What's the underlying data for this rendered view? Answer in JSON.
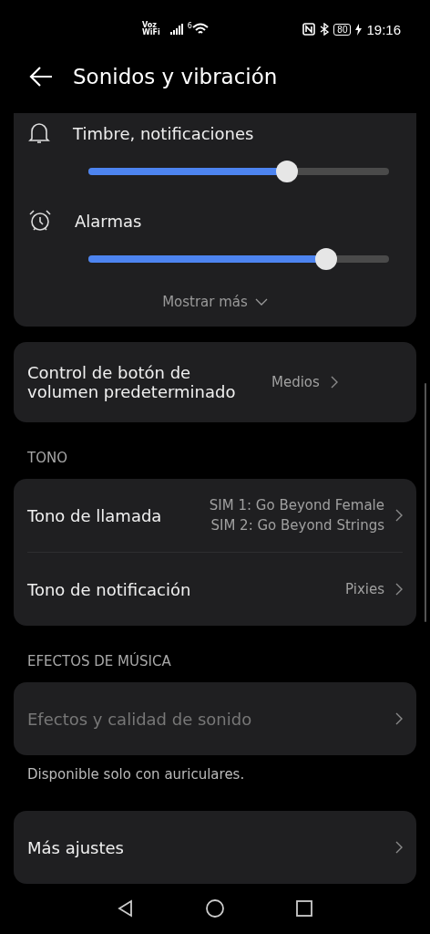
{
  "status_bar": {
    "wifi_calling": "Voz\nWiFi",
    "wifi_badge": "6",
    "battery": "80",
    "time": "19:16"
  },
  "header": {
    "title": "Sonidos y vibración"
  },
  "volume_card": {
    "sliders": [
      {
        "label": "Timbre, notificaciones",
        "level": 0.66
      },
      {
        "label": "Alarmas",
        "level": 0.79
      }
    ],
    "more": "Mostrar más"
  },
  "sections": [
    {
      "items": [
        {
          "label": "Control de botón de volumen predeterminado",
          "values": [
            "Medios"
          ],
          "disabled": false
        }
      ]
    },
    {
      "header": "TONO",
      "items": [
        {
          "label": "Tono de llamada",
          "values": [
            "SIM 1: Go Beyond Female",
            "SIM 2: Go Beyond Strings"
          ],
          "disabled": false
        },
        {
          "label": "Tono de notificación",
          "values": [
            "Pixies"
          ],
          "disabled": false
        }
      ]
    },
    {
      "header": "EFECTOS DE MÚSICA",
      "items": [
        {
          "label": "Efectos y calidad de sonido",
          "disabled": true
        }
      ],
      "note": "Disponible solo con auriculares."
    },
    {
      "items": [
        {
          "label": "Más ajustes",
          "disabled": false
        }
      ]
    }
  ]
}
